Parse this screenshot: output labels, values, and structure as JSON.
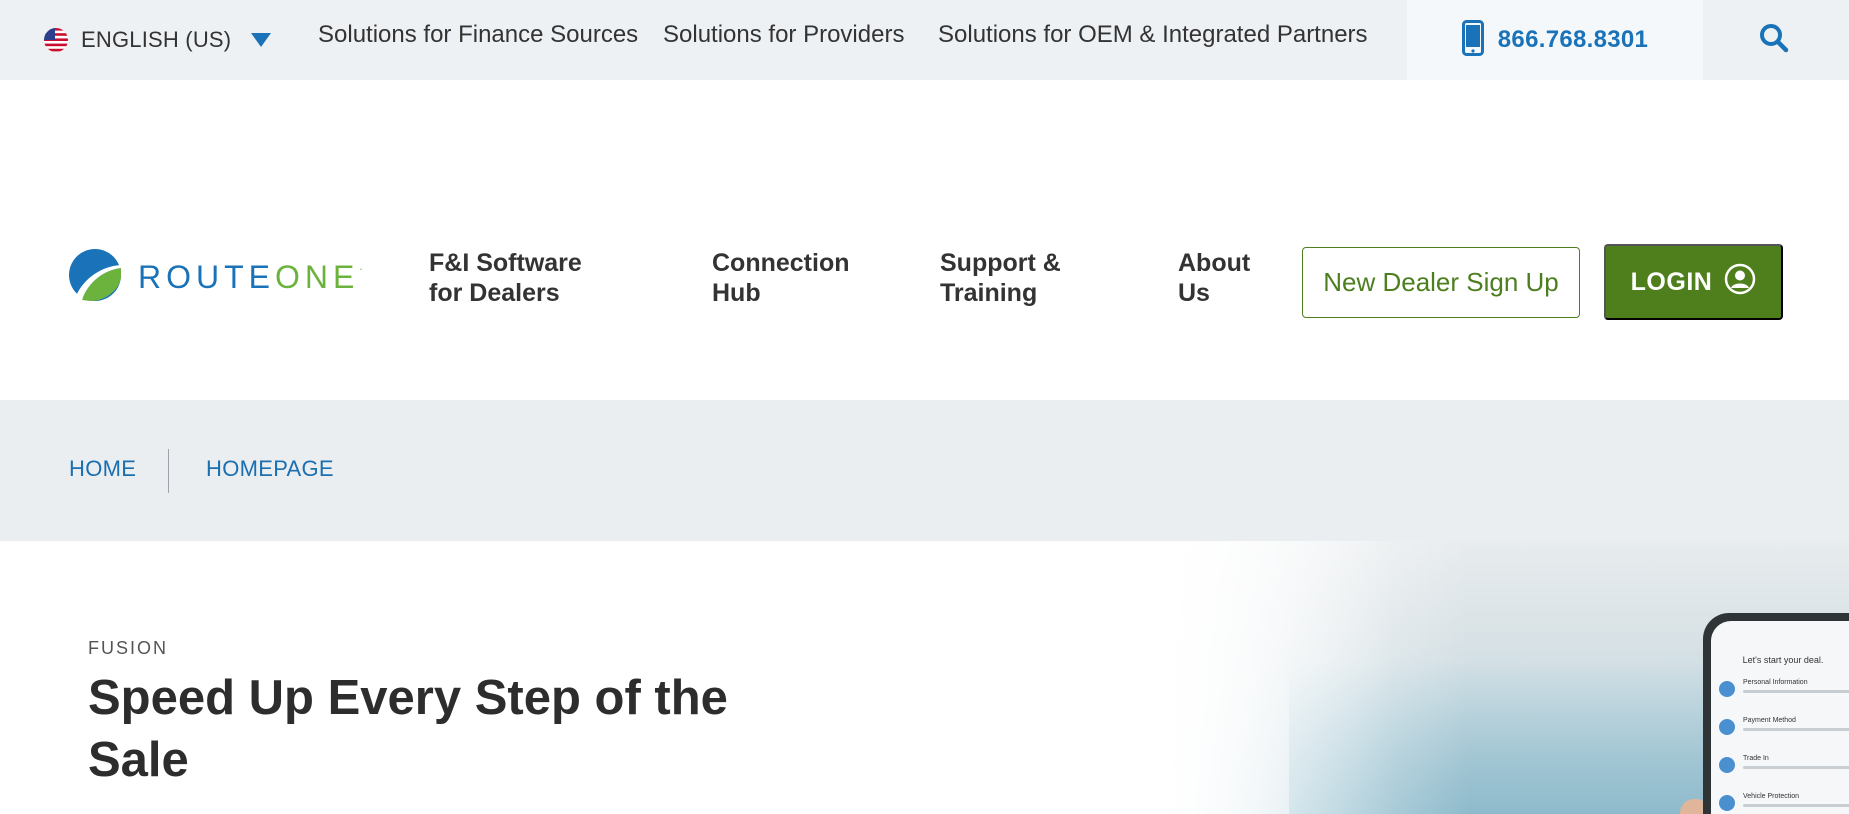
{
  "topbar": {
    "language_label": "ENGLISH (US)",
    "links": [
      "Solutions for Finance Sources",
      "Solutions for Providers",
      "Solutions for OEM & Integrated Partners"
    ],
    "phone": "866.768.8301",
    "icons": {
      "flag": "us-flag-icon",
      "caret": "caret-down-icon",
      "phone": "mobile-phone-icon",
      "search": "search-icon"
    }
  },
  "header": {
    "logo": {
      "part1": "ROUTE",
      "part2": "ONE",
      "mark": "."
    },
    "nav": [
      {
        "line1": "F&I Software",
        "line2": "for Dealers"
      },
      {
        "line1": "Connection",
        "line2": "Hub"
      },
      {
        "line1": "Support &",
        "line2": "Training"
      },
      {
        "line1": "About",
        "line2": "Us"
      }
    ],
    "signup_label": "New Dealer Sign Up",
    "login_label": "LOGIN"
  },
  "breadcrumb": {
    "items": [
      "HOME",
      "HOMEPAGE"
    ]
  },
  "hero": {
    "eyebrow": "FUSION",
    "title": "Speed Up Every Step of the Sale",
    "phone_screen": {
      "title": "Let's start your deal.",
      "rows": [
        "Personal Information",
        "Payment Method",
        "Trade In",
        "Vehicle Protection"
      ]
    }
  },
  "colors": {
    "brand_blue": "#1a73b8",
    "brand_green": "#6cb33e",
    "login_green": "#4f7f1c",
    "topbar_bg": "#eef1f4",
    "breadcrumb_bg": "#ebeef1"
  }
}
